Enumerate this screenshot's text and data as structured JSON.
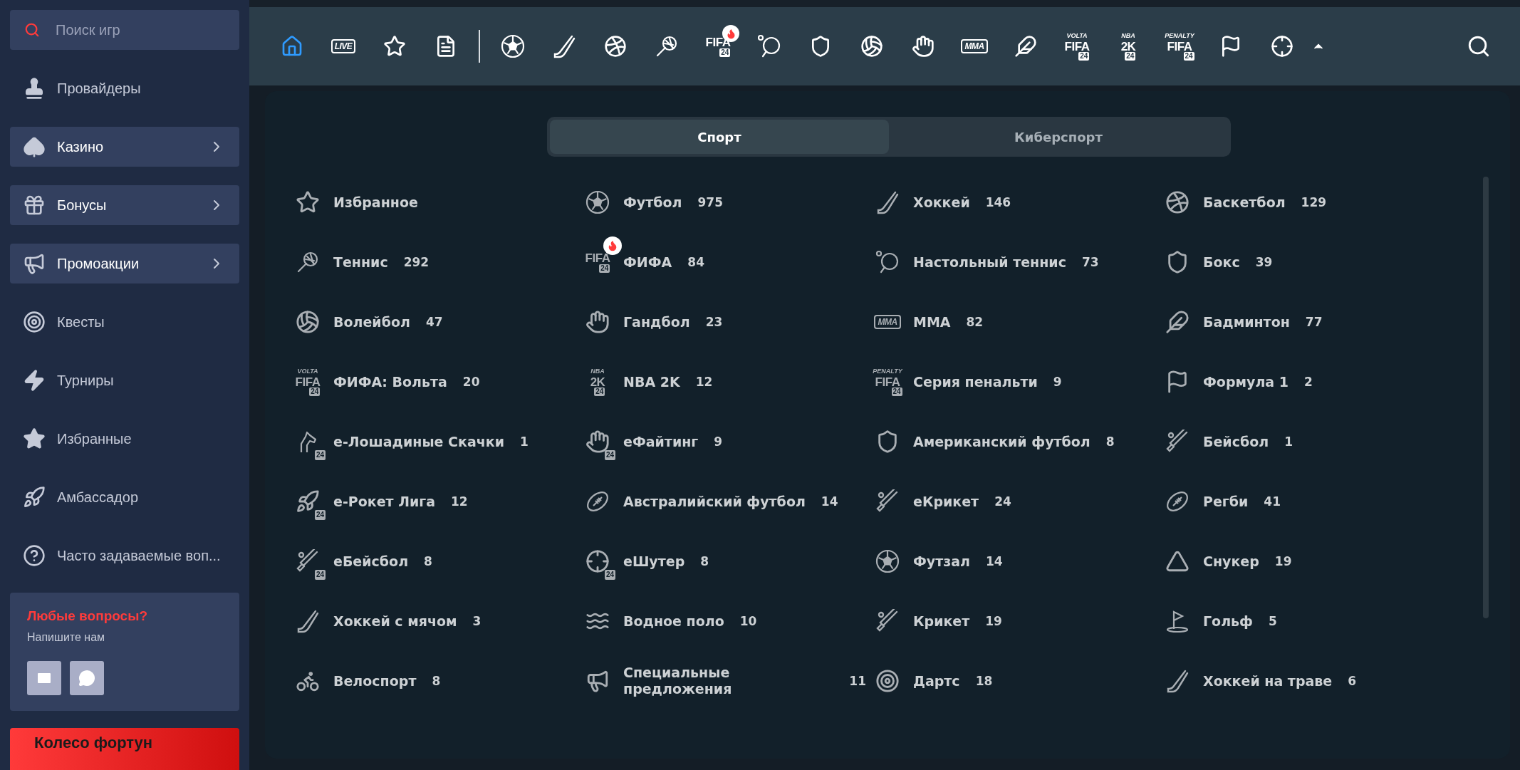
{
  "sidebar": {
    "search": {
      "placeholder": "Поиск игр"
    },
    "items": [
      {
        "label": "Провайдеры",
        "boxed": false,
        "submenu": false
      },
      {
        "label": "Казино",
        "boxed": true,
        "submenu": true
      },
      {
        "label": "Бонусы",
        "boxed": true,
        "submenu": true
      },
      {
        "label": "Промоакции",
        "boxed": true,
        "submenu": true
      },
      {
        "label": "Квесты",
        "boxed": false,
        "submenu": false
      },
      {
        "label": "Турниры",
        "boxed": false,
        "submenu": false
      },
      {
        "label": "Избранные",
        "boxed": false,
        "submenu": false
      },
      {
        "label": "Амбассадор",
        "boxed": false,
        "submenu": false
      },
      {
        "label": "Часто задаваемые воп...",
        "boxed": false,
        "submenu": false
      }
    ],
    "help": {
      "title": "Любые вопросы?",
      "subtitle": "Напишите нам"
    },
    "banner": {
      "title": "Колесо фортун"
    }
  },
  "topbar": {
    "nav": [
      {
        "kind": "home",
        "selected": true
      },
      {
        "kind": "logo",
        "logo": {
          "main": "LIVE"
        },
        "selected": false
      },
      {
        "kind": "star",
        "selected": false
      },
      {
        "kind": "docs",
        "selected": false
      }
    ],
    "sports": [
      {
        "kind": "ball",
        "hot": false
      },
      {
        "kind": "stick",
        "hot": false
      },
      {
        "kind": "basketball",
        "hot": false
      },
      {
        "kind": "racket",
        "hot": false
      },
      {
        "kind": "logo",
        "logo": {
          "main": "FIFA"
        },
        "badge": "24",
        "hot": true
      },
      {
        "kind": "pingpong",
        "hot": false
      },
      {
        "kind": "glove",
        "hot": false
      },
      {
        "kind": "volleyball",
        "hot": false
      },
      {
        "kind": "handball",
        "hot": false
      },
      {
        "kind": "logo",
        "logo": {
          "main": "MMA"
        },
        "hot": false
      },
      {
        "kind": "feather",
        "hot": false
      },
      {
        "kind": "logo",
        "logo": {
          "top": "VOLTA",
          "main": "FIFA"
        },
        "badge": "24",
        "hot": false
      },
      {
        "kind": "logo",
        "logo": {
          "top": "NBA",
          "main": "2K"
        },
        "badge": "24",
        "hot": false
      },
      {
        "kind": "logo",
        "logo": {
          "top": "PENALTY",
          "main": "FIFA"
        },
        "badge": "24",
        "hot": false
      },
      {
        "kind": "flag",
        "hot": false
      },
      {
        "kind": "crosshair",
        "hot": false
      }
    ],
    "menu_expanded": true
  },
  "tabs": [
    {
      "label": "Спорт",
      "selected": true
    },
    {
      "label": "Киберспорт",
      "selected": false
    }
  ],
  "sports": [
    {
      "name": "Избранное",
      "kind": "star",
      "hot": false
    },
    {
      "name": "Футбол",
      "count": "975",
      "kind": "ball",
      "hot": false
    },
    {
      "name": "Хоккей",
      "count": "146",
      "kind": "stick",
      "hot": false
    },
    {
      "name": "Баскетбол",
      "count": "129",
      "kind": "basketball",
      "hot": false
    },
    {
      "name": "Теннис",
      "count": "292",
      "kind": "racket",
      "hot": false
    },
    {
      "name": "ФИФА",
      "count": "84",
      "kind": "logo",
      "logo": {
        "main": "FIFA"
      },
      "badge": "24",
      "hot": true
    },
    {
      "name": "Настольный теннис",
      "count": "73",
      "kind": "pingpong",
      "hot": false
    },
    {
      "name": "Бокс",
      "count": "39",
      "kind": "glove",
      "hot": false
    },
    {
      "name": "Волейбол",
      "count": "47",
      "kind": "volleyball",
      "hot": false
    },
    {
      "name": "Гандбол",
      "count": "23",
      "kind": "handball",
      "hot": false
    },
    {
      "name": "ММА",
      "count": "82",
      "kind": "logo",
      "logo": {
        "main": "MMA"
      },
      "hot": false
    },
    {
      "name": "Бадминтон",
      "count": "77",
      "kind": "feather",
      "hot": false
    },
    {
      "name": "ФИФА: Вольта",
      "count": "20",
      "kind": "logo",
      "logo": {
        "top": "VOLTA",
        "main": "FIFA"
      },
      "badge": "24",
      "hot": false
    },
    {
      "name": "NBA 2K",
      "count": "12",
      "kind": "logo",
      "logo": {
        "top": "NBA",
        "main": "2K"
      },
      "badge": "24",
      "hot": false
    },
    {
      "name": "Серия пенальти",
      "count": "9",
      "kind": "logo",
      "logo": {
        "top": "PENALTY",
        "main": "FIFA"
      },
      "badge": "24",
      "hot": false
    },
    {
      "name": "Формула 1",
      "count": "2",
      "kind": "flag",
      "hot": false
    },
    {
      "name": "е-Лошадиные Скачки",
      "count": "1",
      "kind": "horse",
      "badge": "24",
      "hot": false
    },
    {
      "name": "еФайтинг",
      "count": "9",
      "kind": "fist",
      "badge": "24",
      "hot": false
    },
    {
      "name": "Американский футбол",
      "count": "8",
      "kind": "helmet",
      "hot": false
    },
    {
      "name": "Бейсбол",
      "count": "1",
      "kind": "bat",
      "hot": false
    },
    {
      "name": "е-Рокет Лига",
      "count": "12",
      "kind": "rocket",
      "badge": "24",
      "hot": false
    },
    {
      "name": "Австралийский футбол",
      "count": "14",
      "kind": "oval",
      "hot": false
    },
    {
      "name": "еКрикет",
      "count": "24",
      "kind": "bat",
      "hot": false
    },
    {
      "name": "Регби",
      "count": "41",
      "kind": "oval",
      "hot": false
    },
    {
      "name": "еБейсбол",
      "count": "8",
      "kind": "bat",
      "badge": "24",
      "hot": false
    },
    {
      "name": "еШутер",
      "count": "8",
      "kind": "crosshair",
      "badge": "24",
      "hot": false
    },
    {
      "name": "Футзал",
      "count": "14",
      "kind": "ball",
      "hot": false
    },
    {
      "name": "Снукер",
      "count": "19",
      "kind": "triangle",
      "hot": false
    },
    {
      "name": "Хоккей с мячом",
      "count": "3",
      "kind": "stick",
      "hot": false
    },
    {
      "name": "Водное поло",
      "count": "10",
      "kind": "waves",
      "hot": false
    },
    {
      "name": "Крикет",
      "count": "19",
      "kind": "bat",
      "hot": false
    },
    {
      "name": "Гольф",
      "count": "5",
      "kind": "golf",
      "hot": false
    },
    {
      "name": "Велоспорт",
      "count": "8",
      "kind": "bike",
      "hot": false
    },
    {
      "name": "Специальные предложения",
      "count": "11",
      "kind": "megaphone",
      "hot": false
    },
    {
      "name": "Дартс",
      "count": "18",
      "kind": "target",
      "hot": false
    },
    {
      "name": "Хоккей на траве",
      "count": "6",
      "kind": "stick",
      "hot": false
    }
  ]
}
